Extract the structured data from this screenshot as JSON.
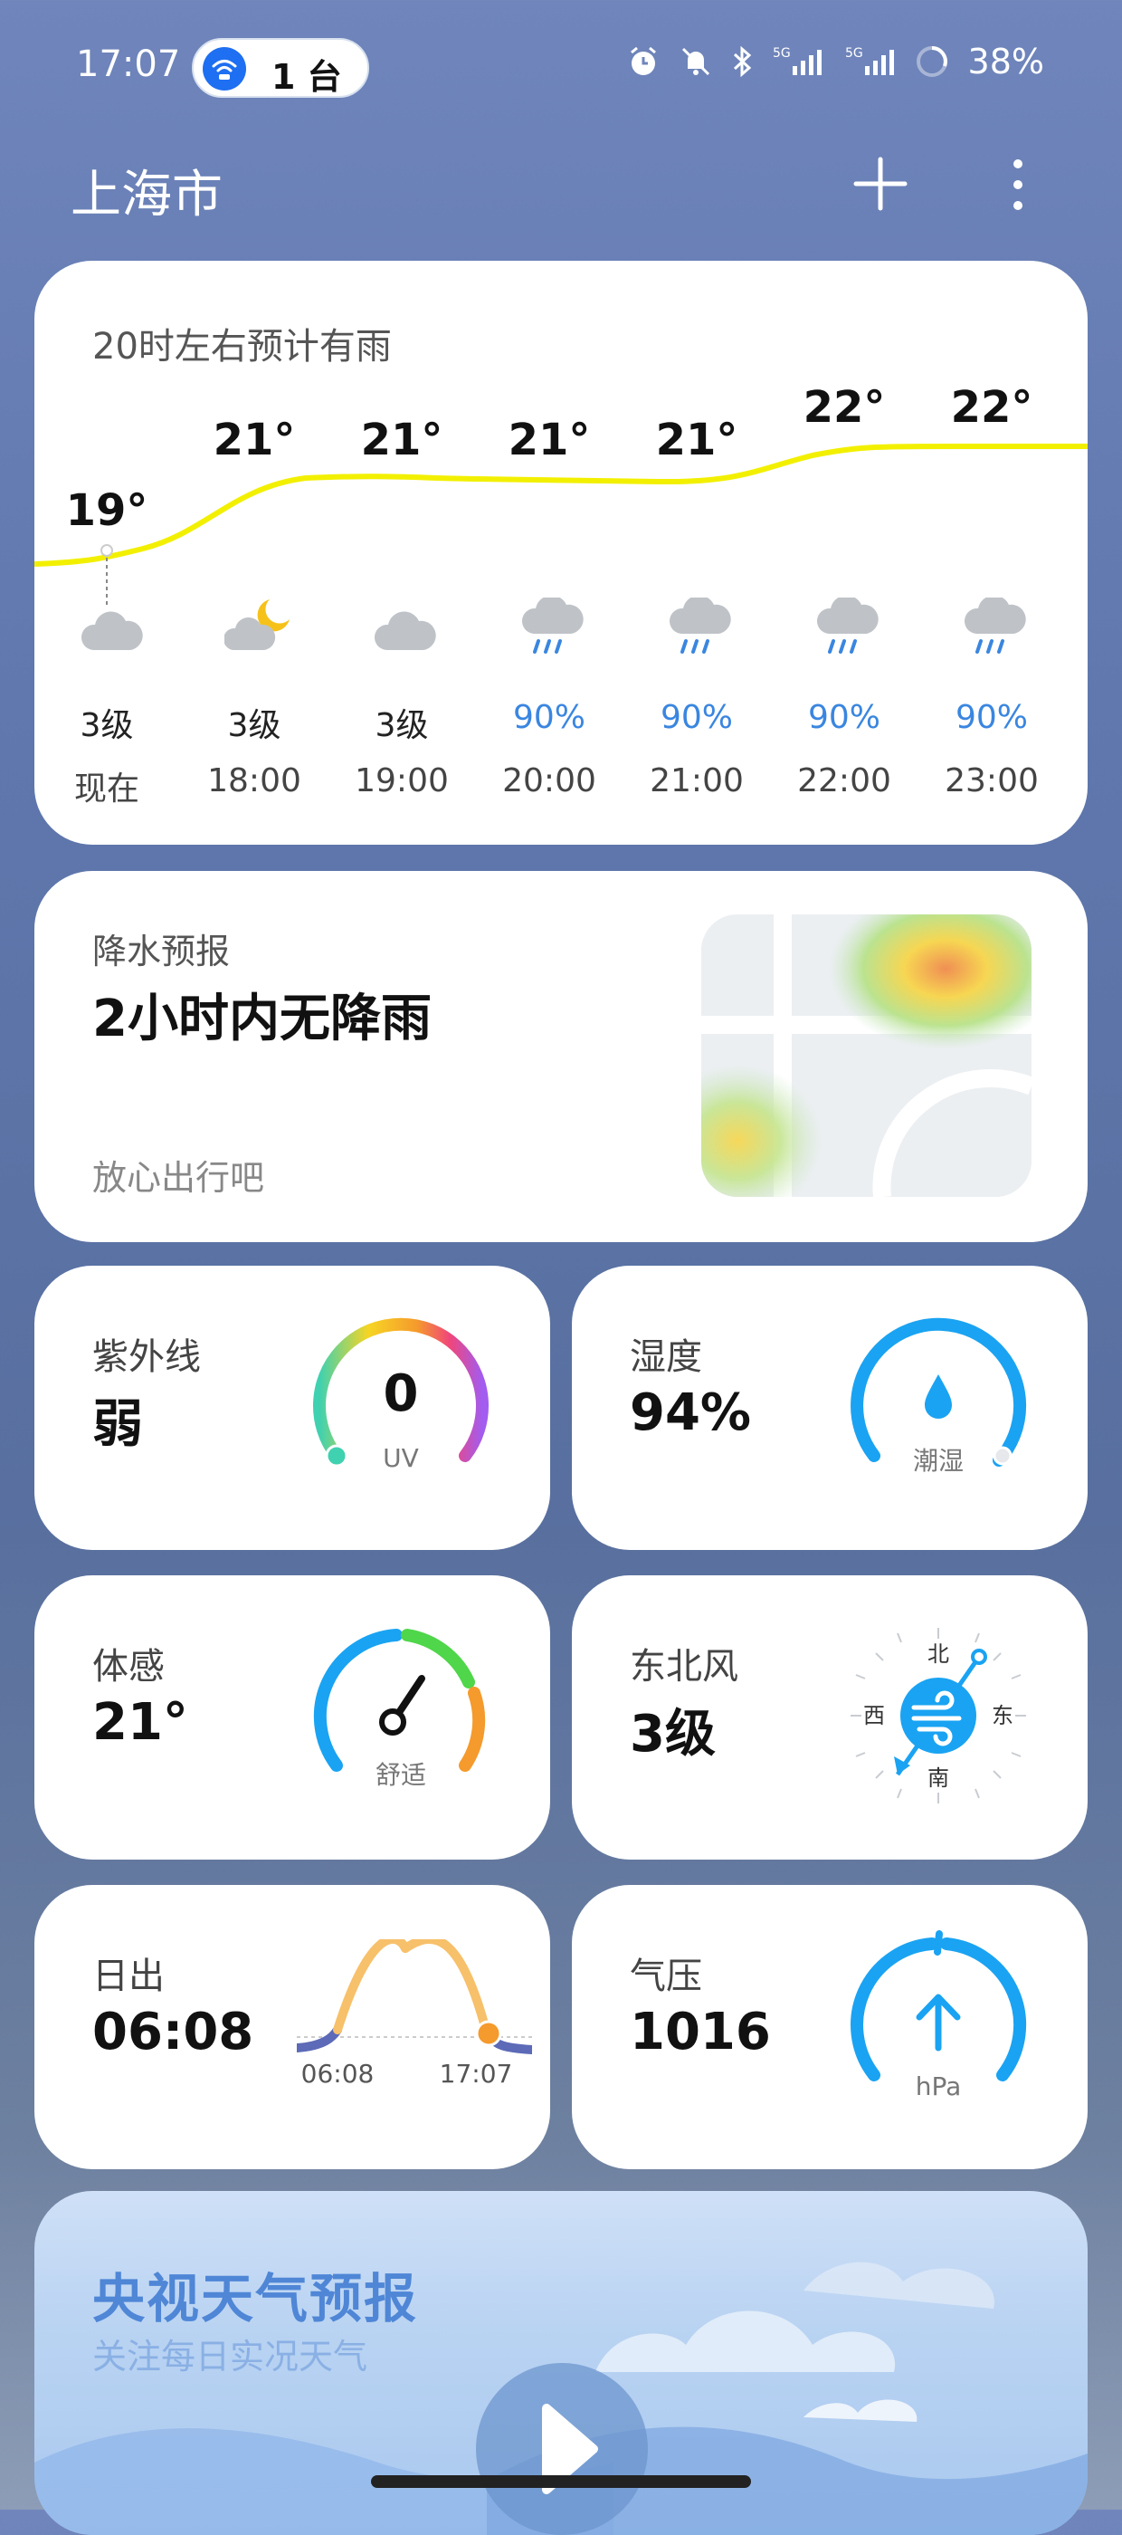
{
  "status_bar": {
    "time": "17:07",
    "device_pill": "1 台",
    "battery": "38%",
    "network_1": "5G",
    "network_2": "5G",
    "icons": [
      "alarm-icon",
      "mute-bell-icon",
      "bluetooth-icon",
      "signal-5g-icon",
      "signal-5g-icon",
      "battery-ring-icon"
    ]
  },
  "header": {
    "city": "上海市"
  },
  "hourly": {
    "title": "20时左右预计有雨",
    "items": [
      {
        "temp": "19°",
        "level": "3级",
        "prob": "",
        "time": "现在",
        "icon": "cloud-icon"
      },
      {
        "temp": "21°",
        "level": "3级",
        "prob": "",
        "time": "18:00",
        "icon": "moon-cloud-icon"
      },
      {
        "temp": "21°",
        "level": "3级",
        "prob": "",
        "time": "19:00",
        "icon": "cloud-icon"
      },
      {
        "temp": "21°",
        "level": "",
        "prob": "90%",
        "time": "20:00",
        "icon": "rain-cloud-icon"
      },
      {
        "temp": "21°",
        "level": "",
        "prob": "90%",
        "time": "21:00",
        "icon": "rain-cloud-icon"
      },
      {
        "temp": "22°",
        "level": "",
        "prob": "90%",
        "time": "22:00",
        "icon": "rain-cloud-icon"
      },
      {
        "temp": "22°",
        "level": "",
        "prob": "90%",
        "time": "23:00",
        "icon": "rain-cloud-icon"
      }
    ]
  },
  "precip": {
    "label": "降水预报",
    "value": "2小时内无降雨",
    "note": "放心出行吧"
  },
  "uv": {
    "label": "紫外线",
    "value": "弱",
    "gauge_value": "0",
    "gauge_unit": "UV"
  },
  "humidity": {
    "label": "湿度",
    "value": "94%",
    "gauge_text": "潮湿",
    "level": 0.94
  },
  "feels": {
    "label": "体感",
    "value": "21°",
    "gauge_text": "舒适"
  },
  "wind": {
    "label": "东北风",
    "value": "3级",
    "dirs": {
      "n": "北",
      "s": "南",
      "w": "西",
      "e": "东"
    }
  },
  "sunrise": {
    "label": "日出",
    "value": "06:08",
    "rise": "06:08",
    "set": "17:07"
  },
  "pressure": {
    "label": "气压",
    "value": "1016",
    "unit": "hPa"
  },
  "tv": {
    "title": "央视天气预报",
    "subtitle": "关注每日实况天气"
  }
}
